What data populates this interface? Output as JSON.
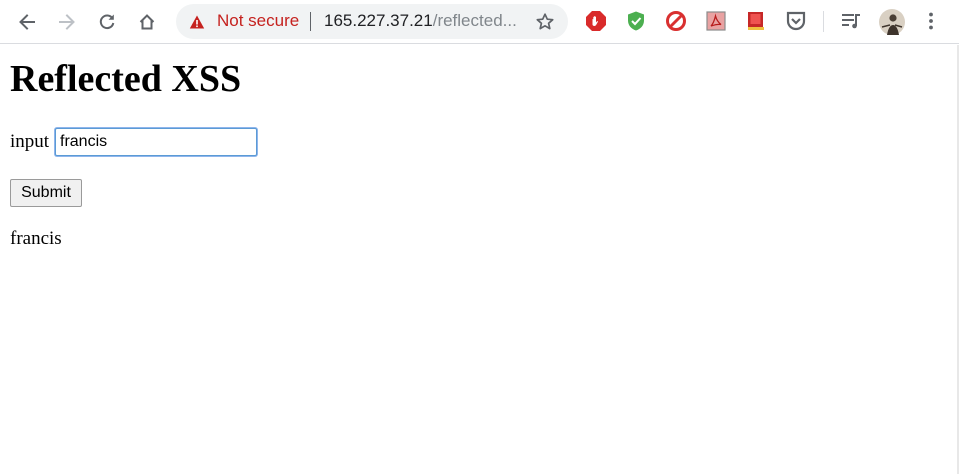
{
  "browser": {
    "security_label": "Not secure",
    "url_host": "165.227.37.21",
    "url_path": "/reflected...",
    "icons": [
      "back-icon",
      "forward-icon",
      "reload-icon",
      "home-icon",
      "warning-icon",
      "star-icon",
      "adblock-icon",
      "shield-check-icon",
      "block-icon",
      "pdf-icon",
      "book-icon",
      "pocket-icon",
      "media-queue-icon",
      "avatar",
      "menu-icon"
    ],
    "colors": {
      "warning": "#c5221f",
      "omnibox_bg": "#f1f3f4",
      "focus_border": "#5b9bd5"
    }
  },
  "page": {
    "title": "Reflected XSS",
    "input_label": "input",
    "input_value": "francis",
    "submit_label": "Submit",
    "output_text": "francis"
  }
}
